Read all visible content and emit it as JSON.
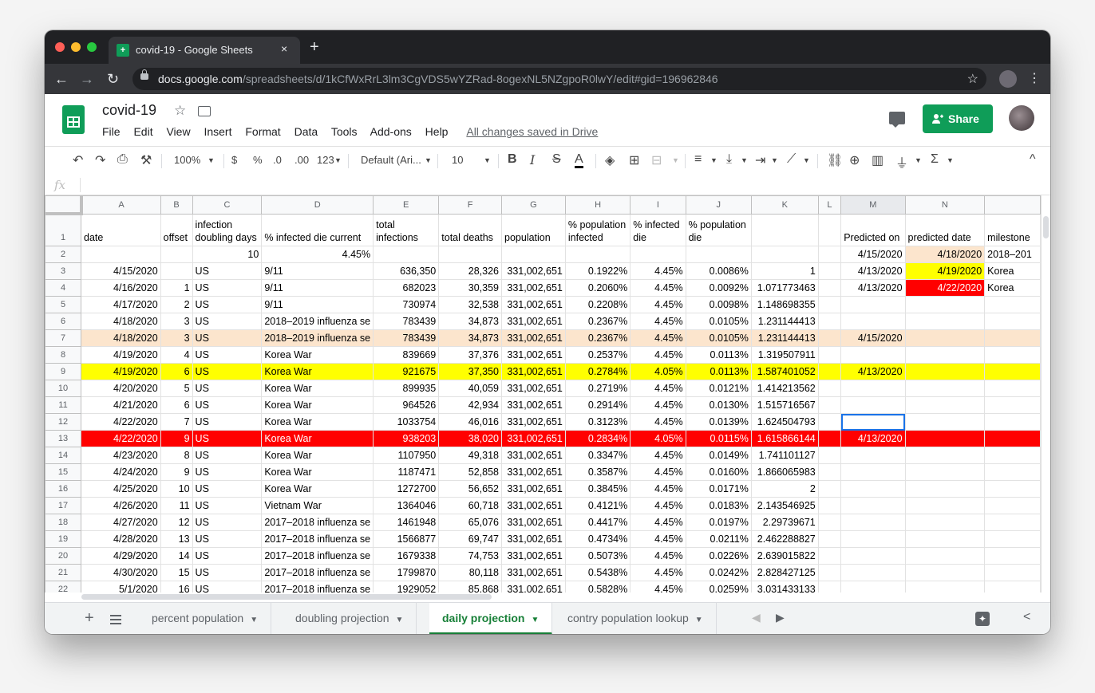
{
  "browser": {
    "tab_title": "covid-19 - Google Sheets",
    "tab_close": "×",
    "new_tab": "+",
    "url_host": "docs.google.com",
    "url_path": "/spreadsheets/d/1kCfWxRrL3lm3CgVDS5wYZRad-8ogexNL5NZgpoR0lwY/edit#gid=196962846",
    "back": "←",
    "forward": "→",
    "reload": "↻",
    "bookmark": "☆",
    "menu": "⋮"
  },
  "doc": {
    "title": "covid-19",
    "star": "☆",
    "menu": [
      "File",
      "Edit",
      "View",
      "Insert",
      "Format",
      "Data",
      "Tools",
      "Add-ons",
      "Help"
    ],
    "saved_status": "All changes saved in Drive",
    "share_label": "Share"
  },
  "toolbar": {
    "zoom": "100%",
    "currency": "$",
    "percent": "%",
    "dec_less": ".0",
    "dec_more": ".00",
    "more_formats": "123",
    "font": "Default (Ari...",
    "font_size": "10",
    "bold": "B",
    "italic": "I",
    "strike": "S",
    "text_color": "A",
    "functions": "Σ",
    "collapse": "^"
  },
  "formula_bar": {
    "fx": "fx",
    "value": ""
  },
  "grid": {
    "columns": [
      "A",
      "B",
      "C",
      "D",
      "E",
      "F",
      "G",
      "H",
      "I",
      "J",
      "K",
      "L",
      "M",
      "N"
    ],
    "header_row": [
      "date",
      "offset",
      "infection doubling days",
      "% infected die current",
      "total infections",
      "total deaths",
      "population",
      "% population infected",
      "% infected die",
      "% population die",
      "",
      "",
      "Predicted on",
      "predicted date",
      "milestone"
    ],
    "row2": [
      "",
      "",
      "10",
      "4.45%",
      "",
      "",
      "",
      "",
      "",
      "",
      "",
      "",
      "4/15/2020",
      "4/18/2020",
      "2018–201"
    ],
    "rows": [
      [
        "4/15/2020",
        "",
        "US",
        "9/11",
        "636,350",
        "28,326",
        "331,002,651",
        "0.1922%",
        "4.45%",
        "0.0086%",
        "1",
        "",
        "4/13/2020",
        "4/19/2020",
        "Korea"
      ],
      [
        "4/16/2020",
        "1",
        "US",
        "9/11",
        "682023",
        "30,359",
        "331,002,651",
        "0.2060%",
        "4.45%",
        "0.0092%",
        "1.071773463",
        "",
        "4/13/2020",
        "4/22/2020",
        "Korea"
      ],
      [
        "4/17/2020",
        "2",
        "US",
        "9/11",
        "730974",
        "32,538",
        "331,002,651",
        "0.2208%",
        "4.45%",
        "0.0098%",
        "1.148698355",
        "",
        "",
        "",
        ""
      ],
      [
        "4/18/2020",
        "3",
        "US",
        "2018–2019 influenza se",
        "783439",
        "34,873",
        "331,002,651",
        "0.2367%",
        "4.45%",
        "0.0105%",
        "1.231144413",
        "",
        "",
        "",
        ""
      ],
      [
        "4/18/2020",
        "3",
        "US",
        "2018–2019 influenza se",
        "783439",
        "34,873",
        "331,002,651",
        "0.2367%",
        "4.45%",
        "0.0105%",
        "1.231144413",
        "",
        "4/15/2020",
        "",
        ""
      ],
      [
        "4/19/2020",
        "4",
        "US",
        "Korea War",
        "839669",
        "37,376",
        "331,002,651",
        "0.2537%",
        "4.45%",
        "0.0113%",
        "1.319507911",
        "",
        "",
        "",
        ""
      ],
      [
        "4/19/2020",
        "6",
        "US",
        "Korea War",
        "921675",
        "37,350",
        "331,002,651",
        "0.2784%",
        "4.05%",
        "0.0113%",
        "1.587401052",
        "",
        "4/13/2020",
        "",
        ""
      ],
      [
        "4/20/2020",
        "5",
        "US",
        "Korea War",
        "899935",
        "40,059",
        "331,002,651",
        "0.2719%",
        "4.45%",
        "0.0121%",
        "1.414213562",
        "",
        "",
        "",
        ""
      ],
      [
        "4/21/2020",
        "6",
        "US",
        "Korea War",
        "964526",
        "42,934",
        "331,002,651",
        "0.2914%",
        "4.45%",
        "0.0130%",
        "1.515716567",
        "",
        "",
        "",
        ""
      ],
      [
        "4/22/2020",
        "7",
        "US",
        "Korea War",
        "1033754",
        "46,016",
        "331,002,651",
        "0.3123%",
        "4.45%",
        "0.0139%",
        "1.624504793",
        "",
        "",
        "",
        ""
      ],
      [
        "4/22/2020",
        "9",
        "US",
        "Korea War",
        "938203",
        "38,020",
        "331,002,651",
        "0.2834%",
        "4.05%",
        "0.0115%",
        "1.615866144",
        "",
        "4/13/2020",
        "",
        ""
      ],
      [
        "4/23/2020",
        "8",
        "US",
        "Korea War",
        "1107950",
        "49,318",
        "331,002,651",
        "0.3347%",
        "4.45%",
        "0.0149%",
        "1.741101127",
        "",
        "",
        "",
        ""
      ],
      [
        "4/24/2020",
        "9",
        "US",
        "Korea War",
        "1187471",
        "52,858",
        "331,002,651",
        "0.3587%",
        "4.45%",
        "0.0160%",
        "1.866065983",
        "",
        "",
        "",
        ""
      ],
      [
        "4/25/2020",
        "10",
        "US",
        "Korea War",
        "1272700",
        "56,652",
        "331,002,651",
        "0.3845%",
        "4.45%",
        "0.0171%",
        "2",
        "",
        "",
        "",
        ""
      ],
      [
        "4/26/2020",
        "11",
        "US",
        "Vietnam War",
        "1364046",
        "60,718",
        "331,002,651",
        "0.4121%",
        "4.45%",
        "0.0183%",
        "2.143546925",
        "",
        "",
        "",
        ""
      ],
      [
        "4/27/2020",
        "12",
        "US",
        "2017–2018 influenza se",
        "1461948",
        "65,076",
        "331,002,651",
        "0.4417%",
        "4.45%",
        "0.0197%",
        "2.29739671",
        "",
        "",
        "",
        ""
      ],
      [
        "4/28/2020",
        "13",
        "US",
        "2017–2018 influenza se",
        "1566877",
        "69,747",
        "331,002,651",
        "0.4734%",
        "4.45%",
        "0.0211%",
        "2.462288827",
        "",
        "",
        "",
        ""
      ],
      [
        "4/29/2020",
        "14",
        "US",
        "2017–2018 influenza se",
        "1679338",
        "74,753",
        "331,002,651",
        "0.5073%",
        "4.45%",
        "0.0226%",
        "2.639015822",
        "",
        "",
        "",
        ""
      ],
      [
        "4/30/2020",
        "15",
        "US",
        "2017–2018 influenza se",
        "1799870",
        "80,118",
        "331,002,651",
        "0.5438%",
        "4.45%",
        "0.0242%",
        "2.828427125",
        "",
        "",
        "",
        ""
      ],
      [
        "5/1/2020",
        "16",
        "US",
        "2017–2018 influenza se",
        "1929052",
        "85,868",
        "331,002,651",
        "0.5828%",
        "4.45%",
        "0.0259%",
        "3.031433133",
        "",
        "",
        "",
        ""
      ]
    ]
  },
  "sheet_tabs": [
    "percent population",
    "doubling projection",
    "daily projection",
    "contry population lookup"
  ],
  "active_sheet": "daily projection",
  "sheet_controls": {
    "add": "+",
    "prev": "◀",
    "next": "▶",
    "collapse": "<"
  },
  "colors": {
    "peach": "#fce5cd",
    "yellow": "#ffff00",
    "red": "#ff0000",
    "sheets_green": "#0f9d58"
  }
}
